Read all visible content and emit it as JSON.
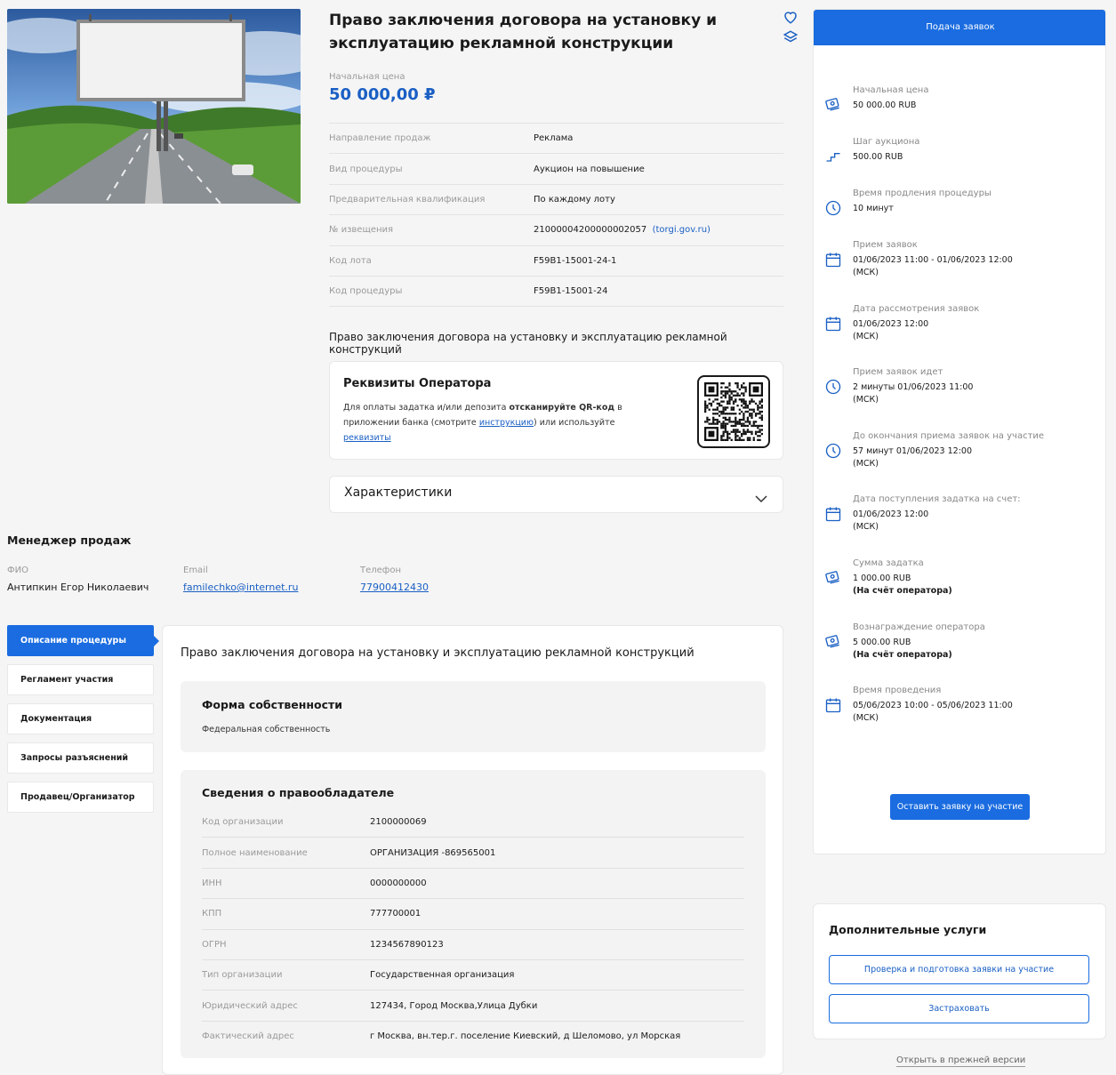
{
  "lot": {
    "title": "Право заключения договора на установку и эксплуатацию рекламной конструкции",
    "start_price_label": "Начальная цена",
    "start_price_value": "50 000,00 ₽",
    "properties": [
      {
        "key": "Направление продаж",
        "value": "Реклама"
      },
      {
        "key": "Вид процедуры",
        "value": "Аукцион на повышение"
      },
      {
        "key": "Предварительная квалификация",
        "value": "По каждому лоту"
      },
      {
        "key": "№ извещения",
        "value": "21000004200000002057",
        "link": "(torgi.gov.ru)"
      },
      {
        "key": "Код лота",
        "value": "F59B1-15001-24-1"
      },
      {
        "key": "Код процедуры",
        "value": "F59B1-15001-24"
      }
    ],
    "description": "Право заключения договора на установку и эксплуатацию рекламной конструкций"
  },
  "operator": {
    "title": "Реквизиты Оператора",
    "text_1": "Для оплаты задатка и/или депозита ",
    "text_bold": "отсканируйте QR-код",
    "text_2": " в приложении банка (смотрите ",
    "link_instruction": "инструкцию",
    "text_3": ") или используйте ",
    "link_requisites": "реквизиты"
  },
  "characteristics": {
    "title": "Характеристики"
  },
  "manager": {
    "title": "Менеджер продаж",
    "fio_label": "ФИО",
    "fio_value": "Антипкин Егор Николаевич",
    "email_label": "Email",
    "email_value": "familechko@internet.ru",
    "phone_label": "Телефон",
    "phone_value": "77900412430"
  },
  "tabs": [
    {
      "label": "Описание процедуры",
      "active": true
    },
    {
      "label": "Регламент участия",
      "active": false
    },
    {
      "label": "Документация",
      "active": false
    },
    {
      "label": "Запросы разъяснений",
      "active": false
    },
    {
      "label": "Продавец/Организатор",
      "active": false
    }
  ],
  "procedure": {
    "title": "Право заключения договора на установку и эксплуатацию рекламной конструкций",
    "ownership_title": "Форма собственности",
    "ownership_value": "Федеральная собственность",
    "holder_title": "Сведения о правообладателе",
    "holder_rows": [
      {
        "key": "Код организации",
        "value": "2100000069"
      },
      {
        "key": "Полное наименование",
        "value": "ОРГАНИЗАЦИЯ -869565001"
      },
      {
        "key": "ИНН",
        "value": "0000000000"
      },
      {
        "key": "КПП",
        "value": "777700001"
      },
      {
        "key": "ОГРН",
        "value": "1234567890123"
      },
      {
        "key": "Тип организации",
        "value": "Государственная организация"
      },
      {
        "key": "Юридический адрес",
        "value": "127434, Город Москва,Улица Дубки"
      },
      {
        "key": "Фактический адрес",
        "value": "г Москва, вн.тер.г. поселение Киевский, д Шеломово, ул Морская"
      }
    ]
  },
  "sidebar": {
    "header": "Подача заявок",
    "items": [
      {
        "icon": "money-icon",
        "label": "Начальная цена",
        "lines": [
          "50 000.00 RUB"
        ]
      },
      {
        "icon": "step-icon",
        "label": "Шаг аукциона",
        "lines": [
          "500.00 RUB"
        ]
      },
      {
        "icon": "clock-icon",
        "label": "Время продления процедуры",
        "lines": [
          "10 минут"
        ]
      },
      {
        "icon": "calendar-icon",
        "label": "Прием заявок",
        "lines": [
          "01/06/2023 11:00  - 01/06/2023 12:00",
          "(МСК)"
        ]
      },
      {
        "icon": "calendar-icon",
        "label": "Дата рассмотрения заявок",
        "lines": [
          "01/06/2023 12:00",
          "(МСК)"
        ]
      },
      {
        "icon": "clock-icon",
        "label": "Прием заявок идет",
        "lines": [
          "2 минуты 01/06/2023 11:00",
          "(МСК)"
        ]
      },
      {
        "icon": "clock-icon",
        "label": "До окончания приема заявок на участие",
        "lines": [
          "57 минут 01/06/2023 12:00",
          "(МСК)"
        ]
      },
      {
        "icon": "calendar-icon",
        "label": "Дата поступления задатка на счет:",
        "lines": [
          "01/06/2023 12:00",
          "(МСК)"
        ]
      },
      {
        "icon": "money-icon",
        "label": "Сумма задатка",
        "lines": [
          "1 000.00 RUB"
        ],
        "bold": "(На счёт оператора)"
      },
      {
        "icon": "money-icon",
        "label": "Вознаграждение оператора",
        "lines": [
          "5 000.00 RUB"
        ],
        "bold": "(На счёт оператора)"
      },
      {
        "icon": "calendar-icon",
        "label": "Время проведения",
        "lines": [
          "05/06/2023 10:00 - 05/06/2023 11:00",
          "(МСК)"
        ]
      }
    ],
    "apply_label": "Оставить заявку на участие"
  },
  "extra": {
    "title": "Дополнительные услуги",
    "check_label": "Проверка и подготовка заявки на участие",
    "insure_label": "Застраховать"
  },
  "old_version_label": "Открыть в прежней версии",
  "colors": {
    "accent": "#1a6ce0",
    "link": "#1a5fc4"
  }
}
